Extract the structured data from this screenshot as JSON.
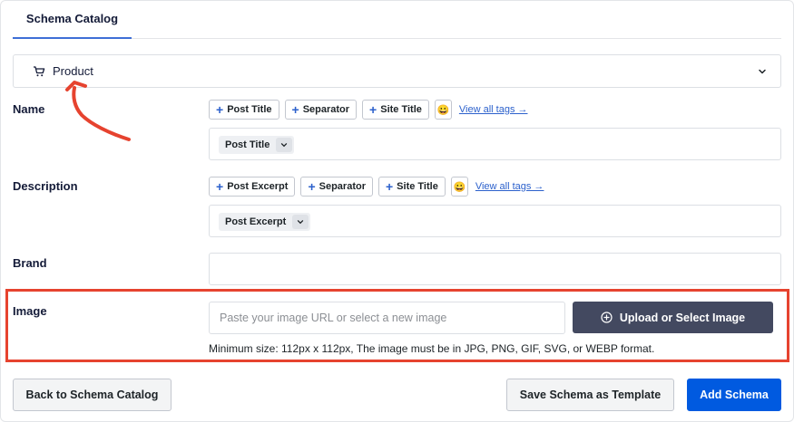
{
  "tabs": [
    {
      "label": "Schema Catalog"
    }
  ],
  "schema_select": {
    "value": "Product",
    "icon": "cart-icon"
  },
  "fields": {
    "name": {
      "label": "Name",
      "tags": [
        "Post Title",
        "Separator",
        "Site Title"
      ],
      "view_all": "View all tags →",
      "value_tag": "Post Title"
    },
    "description": {
      "label": "Description",
      "tags": [
        "Post Excerpt",
        "Separator",
        "Site Title"
      ],
      "view_all": "View all tags →",
      "value_tag": "Post Excerpt"
    },
    "brand": {
      "label": "Brand",
      "value": ""
    },
    "image": {
      "label": "Image",
      "placeholder": "Paste your image URL or select a new image",
      "upload_label": "Upload or Select Image",
      "hint": "Minimum size: 112px x 112px, The image must be in JPG, PNG, GIF, SVG, or WEBP format."
    }
  },
  "actions": {
    "back": "Back to Schema Catalog",
    "save_template": "Save Schema as Template",
    "add": "Add Schema"
  },
  "colors": {
    "accent": "#005ae0",
    "annotation": "#e6432f",
    "dark_button": "#434960",
    "tab_underline": "#3e6fd6"
  }
}
